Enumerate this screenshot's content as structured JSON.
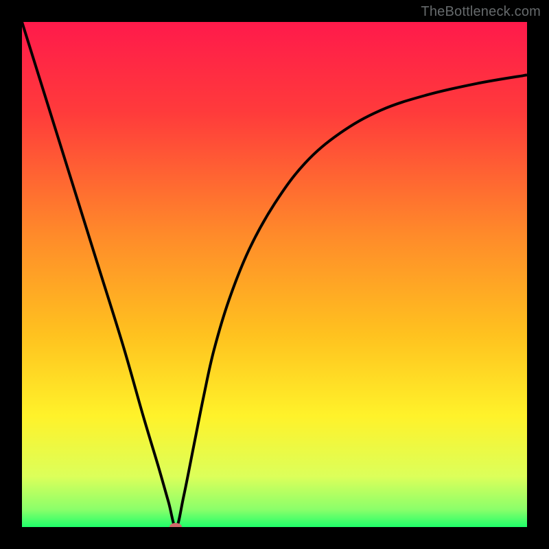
{
  "watermark": {
    "text": "TheBottleneck.com"
  },
  "colors": {
    "frame_bg": "#000000",
    "gradient_stops": [
      {
        "offset": 0.0,
        "color": "#ff1a4b"
      },
      {
        "offset": 0.18,
        "color": "#ff3b3b"
      },
      {
        "offset": 0.42,
        "color": "#ff8a2a"
      },
      {
        "offset": 0.62,
        "color": "#ffc21f"
      },
      {
        "offset": 0.78,
        "color": "#fff22a"
      },
      {
        "offset": 0.9,
        "color": "#dcff5a"
      },
      {
        "offset": 0.965,
        "color": "#8bff6a"
      },
      {
        "offset": 1.0,
        "color": "#1fff6a"
      }
    ],
    "curve_stroke": "#000000",
    "marker_fill": "#cf6a6a"
  },
  "chart_data": {
    "type": "line",
    "title": "",
    "xlabel": "",
    "ylabel": "",
    "xlim": [
      0,
      100
    ],
    "ylim": [
      0,
      100
    ],
    "grid": false,
    "series": [
      {
        "name": "curve",
        "x": [
          0,
          5,
          10,
          15,
          20,
          24,
          27,
          29,
          30.5,
          32,
          34,
          36,
          38,
          41,
          45,
          50,
          56,
          63,
          71,
          80,
          90,
          100
        ],
        "values": [
          100,
          84,
          68,
          52,
          36,
          22,
          12,
          5,
          0,
          6,
          16,
          26,
          35,
          45,
          55,
          64,
          72,
          78,
          82.5,
          85.5,
          87.8,
          89.5
        ]
      }
    ],
    "marker": {
      "x": 30.5,
      "y": 0
    },
    "annotations": []
  }
}
